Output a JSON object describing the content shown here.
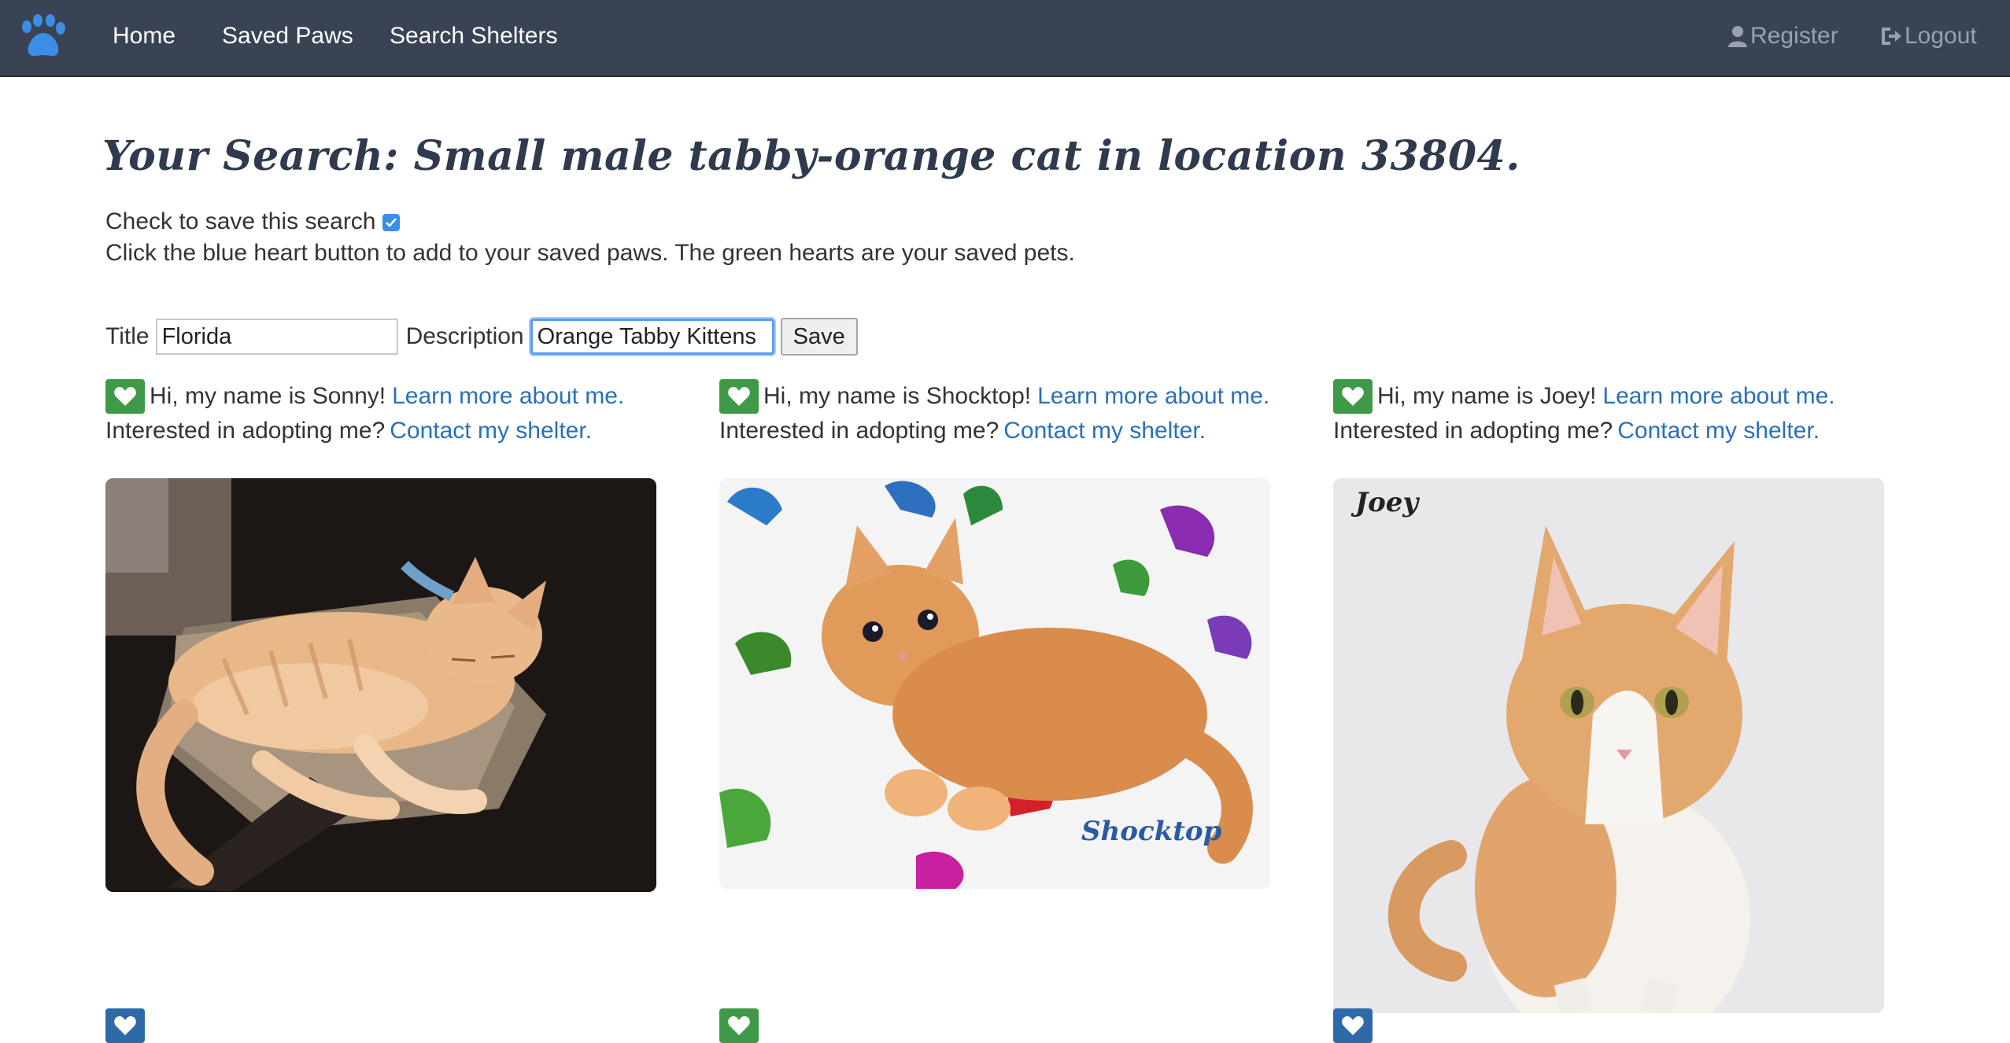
{
  "nav": {
    "home": "Home",
    "saved_paws": "Saved Paws",
    "search_shelters": "Search Shelters",
    "register": "Register",
    "logout": "Logout"
  },
  "page": {
    "title": "Your Search: Small male tabby-orange cat in location 33804.",
    "save_check_label": "Check to save this search",
    "save_checked": true,
    "hint": "Click the blue heart button to add to your saved paws. The green hearts are your saved pets."
  },
  "form": {
    "title_label": "Title",
    "title_value": "Florida",
    "description_label": "Description",
    "description_value": "Orange Tabby Kittens",
    "save_label": "Save"
  },
  "pets": [
    {
      "intro": "Hi, my name is Sonny!",
      "learn_more": "Learn more about me.",
      "adopt_prompt": "Interested in adopting me?",
      "contact": "Contact my shelter.",
      "saved": true
    },
    {
      "intro": "Hi, my name is Shocktop!",
      "learn_more": "Learn more about me.",
      "adopt_prompt": "Interested in adopting me?",
      "contact": "Contact my shelter.",
      "saved": true,
      "photo_caption": "Shocktop"
    },
    {
      "intro": "Hi, my name is Joey!",
      "learn_more": "Learn more about me.",
      "adopt_prompt": "Interested in adopting me?",
      "contact": "Contact my shelter.",
      "saved": true,
      "photo_caption": "Joey"
    }
  ],
  "colors": {
    "navbar": "#3a4354",
    "saved_heart": "#3f9a47",
    "unsaved_heart": "#2f6aa8",
    "link": "#2a70b8"
  }
}
